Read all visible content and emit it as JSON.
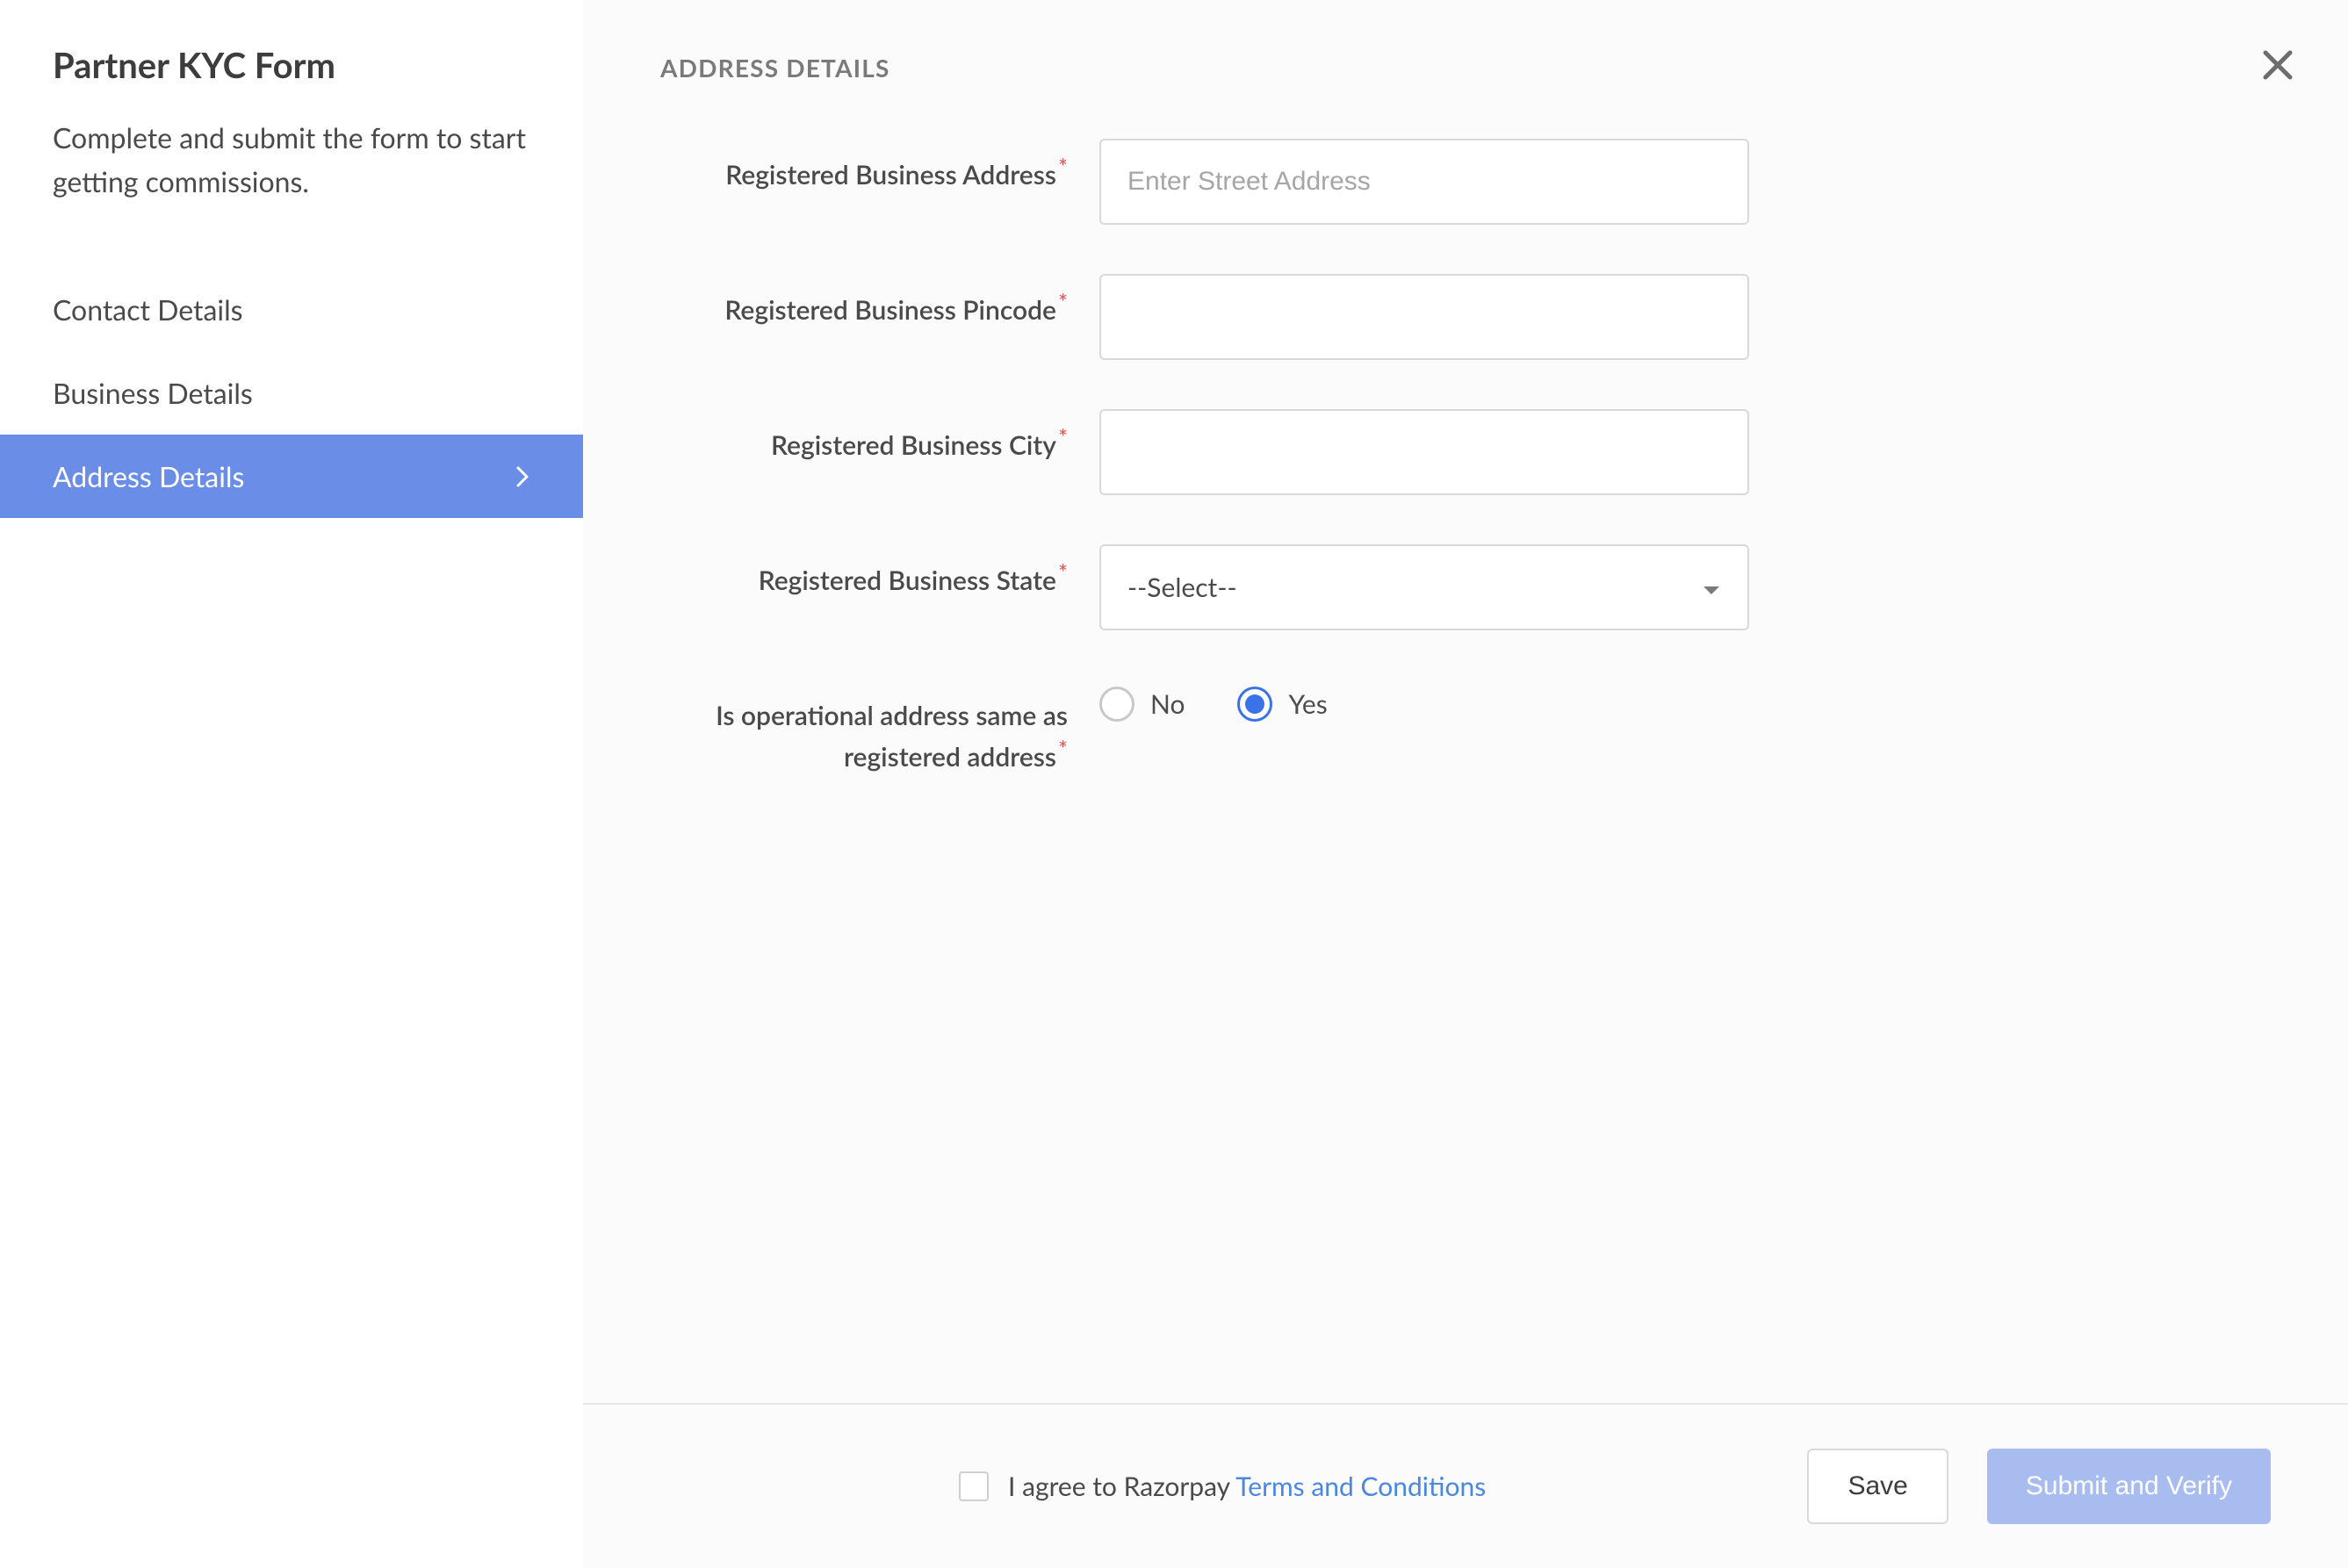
{
  "sidebar": {
    "title": "Partner KYC Form",
    "subtitle": "Complete and submit the form to start getting commissions.",
    "nav": [
      {
        "label": "Contact Details",
        "active": false
      },
      {
        "label": "Business Details",
        "active": false
      },
      {
        "label": "Address Details",
        "active": true
      }
    ]
  },
  "main": {
    "section_title": "ADDRESS DETAILS",
    "fields": {
      "address": {
        "label": "Registered Business Address",
        "placeholder": "Enter Street Address",
        "value": ""
      },
      "pincode": {
        "label": "Registered Business Pincode",
        "placeholder": "",
        "value": ""
      },
      "city": {
        "label": "Registered Business City",
        "placeholder": "",
        "value": ""
      },
      "state": {
        "label": "Registered Business State",
        "selected": "--Select--"
      },
      "same_address": {
        "label": "Is operational address same as registered address",
        "options": {
          "no": "No",
          "yes": "Yes"
        },
        "value": "yes"
      }
    }
  },
  "footer": {
    "agree_prefix": "I agree to Razorpay ",
    "agree_link": "Terms and Conditions",
    "save": "Save",
    "submit": "Submit and Verify"
  },
  "colors": {
    "accent": "#6a8ee7",
    "primary_button": "#a8bcf0",
    "link": "#4a87e0",
    "required": "#e25555"
  }
}
